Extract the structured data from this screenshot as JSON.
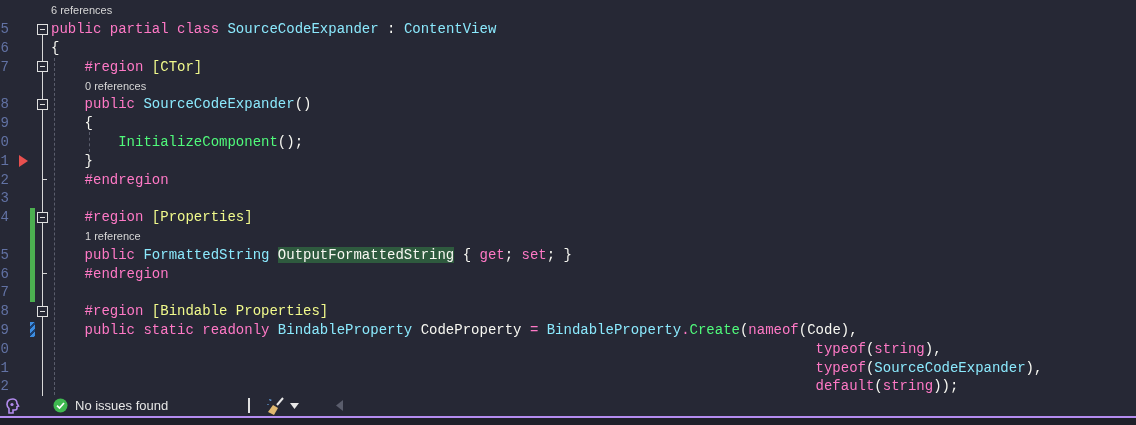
{
  "editor": {
    "rows": [
      {
        "kind": "lens",
        "text": "6 references"
      },
      {
        "kind": "code",
        "number": "5",
        "collapsible": true,
        "tokens": [
          {
            "t": "public partial class ",
            "kind": "keyword"
          },
          {
            "t": "SourceCodeExpander",
            "kind": "type"
          },
          {
            "t": " : ",
            "kind": "plain"
          },
          {
            "t": "ContentView",
            "kind": "type"
          }
        ]
      },
      {
        "kind": "code",
        "number": "6",
        "tokens": [
          {
            "t": "{",
            "kind": "plain"
          }
        ]
      },
      {
        "kind": "code",
        "number": "7",
        "collapsible": true,
        "tokens": [
          {
            "t": "    #region ",
            "kind": "keyword"
          },
          {
            "t": "[CTor]",
            "kind": "region"
          }
        ]
      },
      {
        "kind": "lens",
        "text": "0 references"
      },
      {
        "kind": "code",
        "number": "8",
        "collapsible": true,
        "tokens": [
          {
            "t": "    public ",
            "kind": "keyword"
          },
          {
            "t": "SourceCodeExpander",
            "kind": "type"
          },
          {
            "t": "()",
            "kind": "plain"
          }
        ]
      },
      {
        "kind": "code",
        "number": "9",
        "tokens": [
          {
            "t": "    {",
            "kind": "plain"
          }
        ]
      },
      {
        "kind": "code",
        "number": "0",
        "tokens": [
          {
            "t": "        InitializeComponent",
            "kind": "method"
          },
          {
            "t": "();",
            "kind": "plain"
          }
        ]
      },
      {
        "kind": "code",
        "number": "1",
        "arrow": true,
        "tokens": [
          {
            "t": "    }",
            "kind": "plain"
          }
        ]
      },
      {
        "kind": "code",
        "number": "2",
        "region_end": true,
        "tokens": [
          {
            "t": "    #endregion",
            "kind": "keyword"
          }
        ]
      },
      {
        "kind": "code",
        "number": "3",
        "tokens": []
      },
      {
        "kind": "code",
        "number": "4",
        "collapsible": true,
        "saved_change": true,
        "tokens": [
          {
            "t": "    #region ",
            "kind": "keyword"
          },
          {
            "t": "[Properties]",
            "kind": "region"
          }
        ]
      },
      {
        "kind": "lens",
        "text": "1 reference",
        "saved_change": true
      },
      {
        "kind": "code",
        "number": "5",
        "saved_change": true,
        "tokens": [
          {
            "t": "    public ",
            "kind": "keyword"
          },
          {
            "t": "FormattedString ",
            "kind": "type"
          },
          {
            "t": "OutputFormattedString",
            "kind": "highlight"
          },
          {
            "t": " { ",
            "kind": "plain"
          },
          {
            "t": "get",
            "kind": "keyword"
          },
          {
            "t": "; ",
            "kind": "plain"
          },
          {
            "t": "set",
            "kind": "keyword"
          },
          {
            "t": "; }",
            "kind": "plain"
          }
        ]
      },
      {
        "kind": "code",
        "number": "6",
        "region_end": true,
        "saved_change": true,
        "tokens": [
          {
            "t": "    #endregion",
            "kind": "keyword"
          }
        ]
      },
      {
        "kind": "code",
        "number": "7",
        "saved_change": true,
        "tokens": []
      },
      {
        "kind": "code",
        "number": "8",
        "collapsible": true,
        "tokens": [
          {
            "t": "    #region ",
            "kind": "keyword"
          },
          {
            "t": "[Bindable Properties]",
            "kind": "region"
          }
        ]
      },
      {
        "kind": "code",
        "number": "9",
        "unsaved_change": true,
        "tokens": [
          {
            "t": "    public static readonly ",
            "kind": "keyword"
          },
          {
            "t": "BindableProperty",
            "kind": "type"
          },
          {
            "t": " CodeProperty ",
            "kind": "plain"
          },
          {
            "t": "= ",
            "kind": "keyword"
          },
          {
            "t": "BindableProperty",
            "kind": "type"
          },
          {
            "t": ".",
            "kind": "keyword"
          },
          {
            "t": "Create",
            "kind": "method"
          },
          {
            "t": "(",
            "kind": "plain"
          },
          {
            "t": "nameof",
            "kind": "keyword"
          },
          {
            "t": "(Code),",
            "kind": "plain"
          }
        ]
      },
      {
        "kind": "code",
        "number": "0",
        "tokens": [
          {
            "t": "                                                                                           typeof",
            "kind": "keyword"
          },
          {
            "t": "(",
            "kind": "plain"
          },
          {
            "t": "string",
            "kind": "keyword"
          },
          {
            "t": "),",
            "kind": "plain"
          }
        ]
      },
      {
        "kind": "code",
        "number": "1",
        "tokens": [
          {
            "t": "                                                                                           typeof",
            "kind": "keyword"
          },
          {
            "t": "(",
            "kind": "plain"
          },
          {
            "t": "SourceCodeExpander",
            "kind": "type"
          },
          {
            "t": "),",
            "kind": "plain"
          }
        ]
      },
      {
        "kind": "code",
        "number": "2",
        "tokens": [
          {
            "t": "                                                                                           default",
            "kind": "keyword"
          },
          {
            "t": "(",
            "kind": "plain"
          },
          {
            "t": "string",
            "kind": "keyword"
          },
          {
            "t": "));",
            "kind": "plain"
          }
        ]
      }
    ]
  },
  "status_bar": {
    "issues": "No issues found"
  }
}
